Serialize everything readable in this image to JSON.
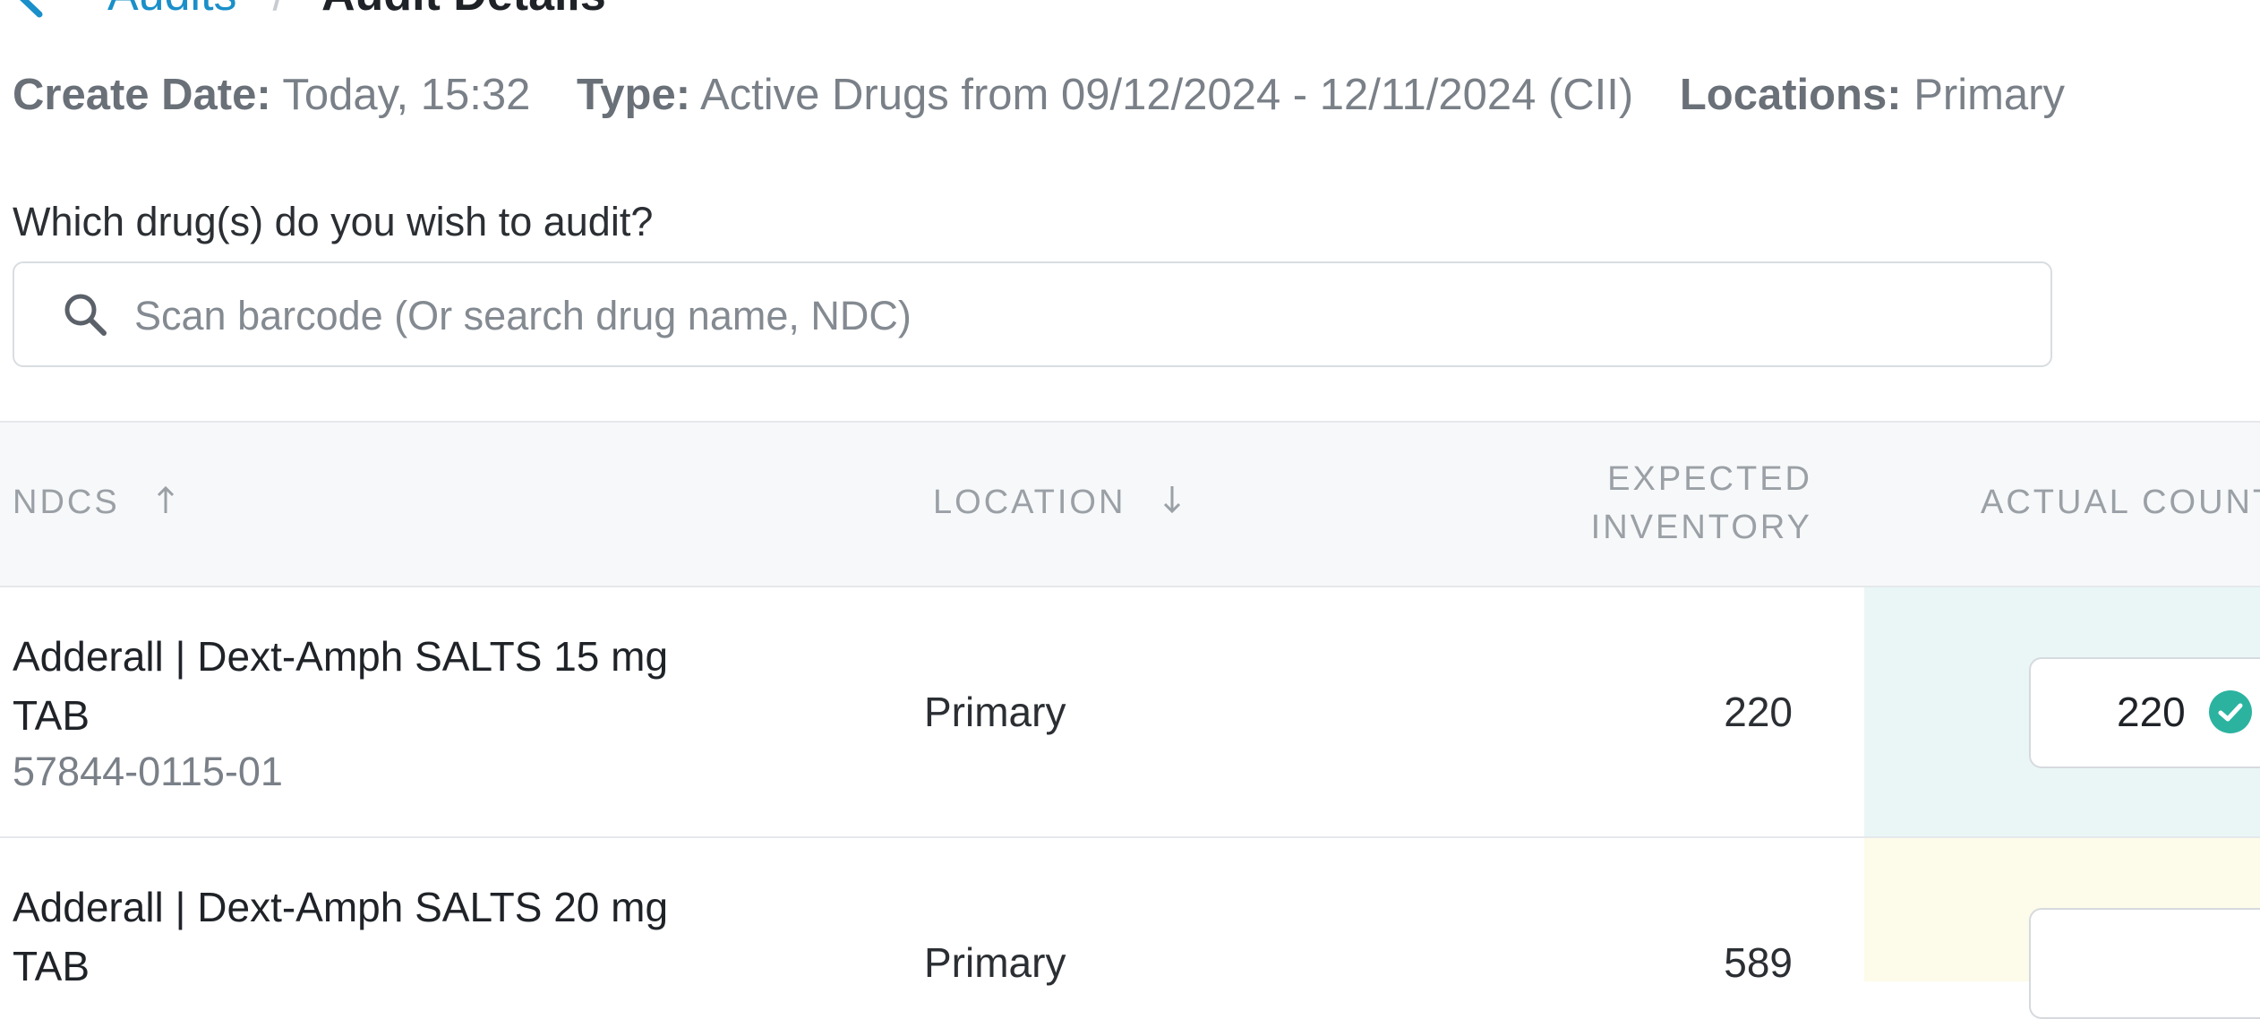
{
  "breadcrumb": {
    "back_icon": "chevron-left-icon",
    "parent": "Audits",
    "separator": "/",
    "current": "Audit Details"
  },
  "meta": {
    "create_date_label": "Create Date:",
    "create_date_value": "Today, 15:32",
    "type_label": "Type:",
    "type_value": "Active Drugs from 09/12/2024 - 12/11/2024 (CII)",
    "locations_label": "Locations:",
    "locations_value": "Primary"
  },
  "search": {
    "prompt": "Which drug(s) do you wish to audit?",
    "placeholder": "Scan barcode (Or search drug name, NDC)",
    "icon": "search-icon"
  },
  "table": {
    "columns": {
      "ndcs": "NDCS",
      "location": "LOCATION",
      "expected_line1": "EXPECTED",
      "expected_line2": "INVENTORY",
      "actual": "ACTUAL COUNT"
    },
    "sort_icons": {
      "ndcs": "arrow-up-icon",
      "location": "arrow-down-icon"
    },
    "rows": [
      {
        "name_line1": "Adderall | Dext-Amph SALTS 15 mg",
        "name_line2": "TAB",
        "ndc": "57844-0115-01",
        "location": "Primary",
        "expected": "220",
        "actual": "220",
        "status_icon": "check-circle-icon",
        "status_color": "#2bb3a0"
      },
      {
        "name_line1": "Adderall | Dext-Amph SALTS 20 mg",
        "name_line2": "TAB",
        "location": "Primary",
        "expected": "589",
        "actual": ""
      }
    ]
  },
  "colors": {
    "link": "#1a8fc9",
    "matched_row_bg": "#eaf6f6",
    "pending_row_bg": "#fdfbe9",
    "check": "#2bb3a0"
  }
}
